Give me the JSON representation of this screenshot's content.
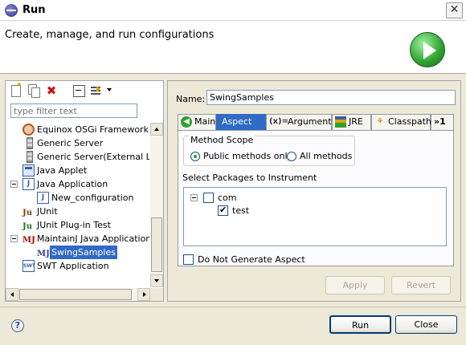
{
  "window": {
    "title": "Run"
  },
  "header": {
    "heading": "Create, manage, and run configurations"
  },
  "left_panel": {
    "filter_placeholder": "type filter text",
    "tree": [
      {
        "label": "Equinox OSGi Framework",
        "icon": "osgi-framework-icon"
      },
      {
        "label": "Generic Server",
        "icon": "server-icon"
      },
      {
        "label": "Generic Server(External La",
        "icon": "server-icon"
      },
      {
        "label": "Java Applet",
        "icon": "java-applet-icon"
      },
      {
        "label": "Java Application",
        "icon": "java-application-icon",
        "expanded": true
      },
      {
        "label": "New_configuration",
        "icon": "java-config-icon"
      },
      {
        "label": "JUnit",
        "icon": "junit-icon"
      },
      {
        "label": "JUnit Plug-in Test",
        "icon": "junit-plugin-icon"
      },
      {
        "label": "MaintainJ Java Application",
        "icon": "maintainj-icon",
        "expanded": true
      },
      {
        "label": "SwingSamples",
        "icon": "maintainj-config-icon",
        "selected": true
      },
      {
        "label": "SWT Application",
        "icon": "swt-icon"
      }
    ]
  },
  "right_panel": {
    "name_label": "Name:",
    "name_value": "SwingSamples",
    "tabs": [
      {
        "label": "Main",
        "icon": "main-tab-icon"
      },
      {
        "label": "Aspect",
        "active": true
      },
      {
        "label": "Arguments",
        "icon": "arguments-icon",
        "icon_text": "(x)="
      },
      {
        "label": "JRE",
        "icon": "jre-icon"
      },
      {
        "label": "Classpath",
        "icon": "classpath-icon"
      },
      {
        "label": "»1",
        "icon": "more-tabs-icon"
      }
    ],
    "method_scope": {
      "title": "Method Scope",
      "options": [
        {
          "label": "Public methods only",
          "selected": true
        },
        {
          "label": "All methods",
          "selected": false
        }
      ]
    },
    "packages": {
      "label": "Select Packages to Instrument",
      "items": [
        {
          "label": "com",
          "checked": false,
          "expanded": true
        },
        {
          "label": "test",
          "checked": true
        }
      ]
    },
    "do_not_generate": {
      "label": "Do Not Generate Aspect",
      "checked": false
    },
    "apply_label": "Apply",
    "revert_label": "Revert"
  },
  "footer": {
    "run_label": "Run",
    "close_label": "Close"
  }
}
